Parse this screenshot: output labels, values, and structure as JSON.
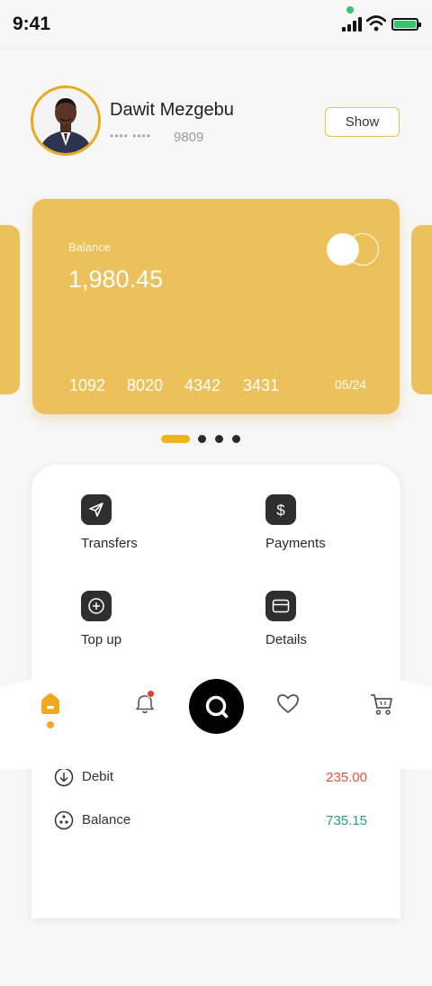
{
  "status_bar": {
    "time": "9:41",
    "battery_color": "#31c76a",
    "camera_indicator_color": "#31c76a"
  },
  "profile": {
    "name": "Dawit Mezgebu",
    "account_mask": "•••• ••••",
    "account_last4": "9809",
    "show_label": "Show",
    "avatar_border_color": "#e9a91d"
  },
  "card": {
    "balance_label": "Balance",
    "balance_value": "1,980.45",
    "number_groups": [
      "1092",
      "8020",
      "4342",
      "3431"
    ],
    "expiry": "05/24",
    "brand_icon": "mastercard-logo-icon",
    "color": "#ecc05a"
  },
  "pager": {
    "count": 4,
    "active_index": 0,
    "accent": "#f0b21d"
  },
  "actions": [
    {
      "label": "Transfers",
      "icon": "send-icon"
    },
    {
      "label": "Payments",
      "icon": "dollar-icon"
    },
    {
      "label": "Top up",
      "icon": "plus-circle-icon"
    },
    {
      "label": "Details",
      "icon": "card-icon"
    }
  ],
  "transactions": [
    {
      "label": "Debit",
      "value": "235.00",
      "icon": "arrow-down-circle-icon",
      "color": "#e0543a"
    },
    {
      "label": "Balance",
      "value": "735.15",
      "icon": "dots-circle-icon",
      "color": "#2a9c86"
    }
  ],
  "bottom_nav": {
    "items": [
      "home-icon",
      "bell-icon",
      "search-icon",
      "heart-icon",
      "cart-icon"
    ],
    "active": "home-icon",
    "accent": "#f0a81d",
    "badge_color": "#e23c2c"
  }
}
